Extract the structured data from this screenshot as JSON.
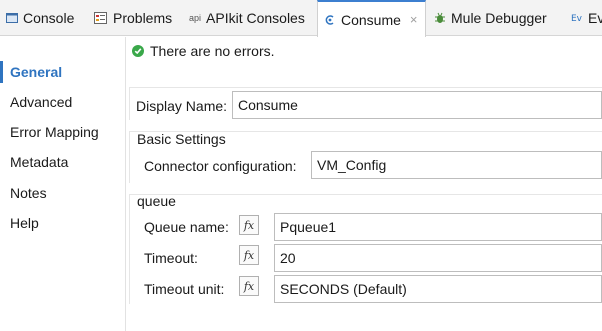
{
  "tabs": [
    {
      "label": "Console",
      "icon": "console-icon"
    },
    {
      "label": "Problems",
      "icon": "problems-icon"
    },
    {
      "label": "APIkit Consoles",
      "icon": "api-icon",
      "icon_text": "api"
    },
    {
      "label": "Consume",
      "icon": "consume-icon",
      "active": true,
      "close": "×"
    },
    {
      "label": "Mule Debugger",
      "icon": "debug-bug-icon"
    },
    {
      "label": "Ev",
      "icon": "events-icon"
    }
  ],
  "nav": {
    "items": [
      {
        "label": "General",
        "active": true
      },
      {
        "label": "Advanced"
      },
      {
        "label": "Error Mapping"
      },
      {
        "label": "Metadata"
      },
      {
        "label": "Notes"
      },
      {
        "label": "Help"
      }
    ]
  },
  "status": {
    "text": "There are no errors.",
    "icon": "check-circle-icon"
  },
  "general": {
    "display_name_label": "Display Name:",
    "display_name_value": "Consume"
  },
  "basic_settings": {
    "title": "Basic Settings",
    "connector_label": "Connector configuration:",
    "connector_value": "VM_Config"
  },
  "queue": {
    "title": "queue",
    "fx_label": "fx",
    "queue_name_label": "Queue name:",
    "queue_name_value": "Pqueue1",
    "timeout_label": "Timeout:",
    "timeout_value": "20",
    "timeout_unit_label": "Timeout unit:",
    "timeout_unit_value": "SECONDS (Default)"
  },
  "colors": {
    "accent": "#2f74c0",
    "ok": "#3aa84a"
  }
}
